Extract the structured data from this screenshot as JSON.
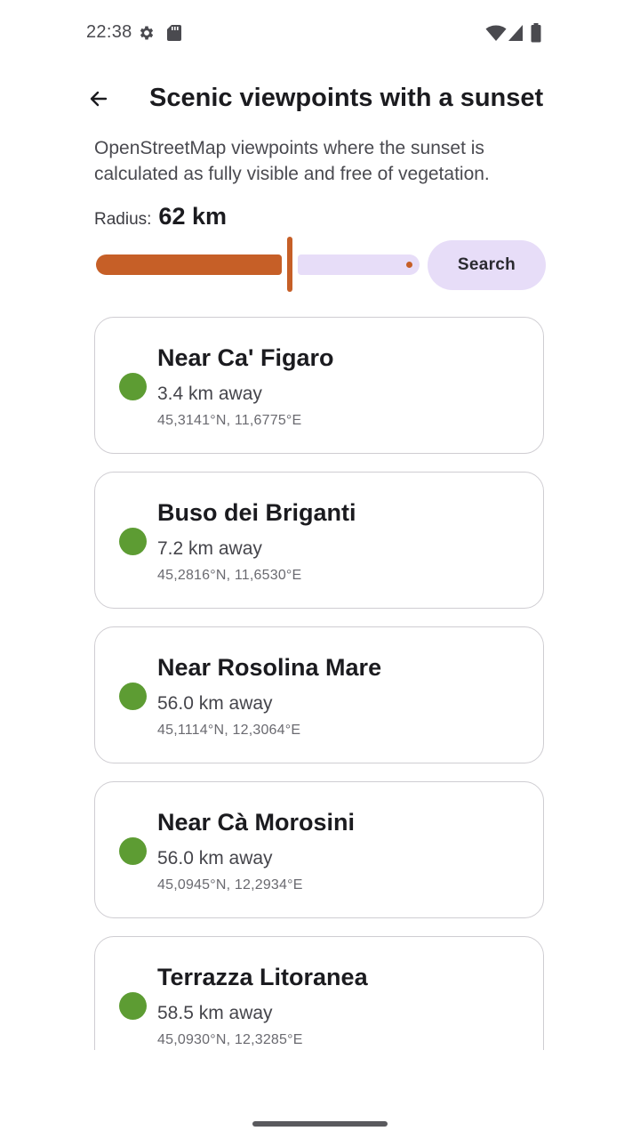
{
  "status_bar": {
    "time": "22:38",
    "left_icons": [
      "gear-icon",
      "sd-card-icon"
    ],
    "right_icons": [
      "wifi-icon",
      "cell-signal-icon",
      "battery-icon"
    ]
  },
  "header": {
    "back_icon": "arrow-back-icon",
    "title": "Scenic viewpoints with a sunset"
  },
  "description": "OpenStreetMap viewpoints where the sunset is calculated as fully visible and free of vegetation.",
  "radius": {
    "label": "Radius:",
    "value_text": "62 km",
    "slider_fraction": 0.6
  },
  "search": {
    "label": "Search"
  },
  "colors": {
    "accent": "#c65f27",
    "track_inactive": "#e7ddf8",
    "status_dot": "#5d9c33"
  },
  "viewpoints": [
    {
      "name": "Near Ca' Figaro",
      "distance": "3.4 km away",
      "coords": "45,3141°N, 11,6775°E"
    },
    {
      "name": "Buso dei Briganti",
      "distance": "7.2 km away",
      "coords": "45,2816°N, 11,6530°E"
    },
    {
      "name": "Near Rosolina Mare",
      "distance": "56.0 km away",
      "coords": "45,1114°N, 12,3064°E"
    },
    {
      "name": "Near Cà Morosini",
      "distance": "56.0 km away",
      "coords": "45,0945°N, 12,2934°E"
    },
    {
      "name": "Terrazza Litoranea",
      "distance": "58.5 km away",
      "coords": "45,0930°N, 12,3285°E"
    }
  ]
}
